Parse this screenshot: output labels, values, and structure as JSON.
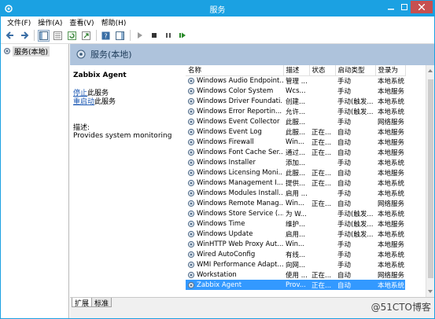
{
  "window": {
    "title": "服务"
  },
  "menu": [
    "文件(F)",
    "操作(A)",
    "查看(V)",
    "帮助(H)"
  ],
  "tree": {
    "root_label": "服务(本地)"
  },
  "header": {
    "title": "服务(本地)"
  },
  "details": {
    "service_name": "Zabbix Agent",
    "stop_link": "停止",
    "stop_suffix": "此服务",
    "restart_link": "重启动",
    "restart_suffix": "此服务",
    "desc_label": "描述:",
    "desc_text": "Provides system monitoring"
  },
  "columns": [
    "名称",
    "描述",
    "状态",
    "启动类型",
    "登录为"
  ],
  "rows": [
    {
      "name": "Windows Audio Endpoint...",
      "desc": "管理 ...",
      "status": "",
      "startup": "手动",
      "logon": "本地系统"
    },
    {
      "name": "Windows Color System",
      "desc": "Wcs...",
      "status": "",
      "startup": "手动",
      "logon": "本地服务"
    },
    {
      "name": "Windows Driver Foundati...",
      "desc": "创建...",
      "status": "",
      "startup": "手动(触发...",
      "logon": "本地系统"
    },
    {
      "name": "Windows Error Reportin...",
      "desc": "允许...",
      "status": "",
      "startup": "手动(触发...",
      "logon": "本地系统"
    },
    {
      "name": "Windows Event Collector",
      "desc": "此服...",
      "status": "",
      "startup": "手动",
      "logon": "网络服务"
    },
    {
      "name": "Windows Event Log",
      "desc": "此服...",
      "status": "正在...",
      "startup": "自动",
      "logon": "本地服务"
    },
    {
      "name": "Windows Firewall",
      "desc": "Win...",
      "status": "正在...",
      "startup": "自动",
      "logon": "本地服务"
    },
    {
      "name": "Windows Font Cache Ser...",
      "desc": "通过...",
      "status": "正在...",
      "startup": "自动",
      "logon": "本地服务"
    },
    {
      "name": "Windows Installer",
      "desc": "添加...",
      "status": "",
      "startup": "手动",
      "logon": "本地系统"
    },
    {
      "name": "Windows Licensing Moni...",
      "desc": "此服...",
      "status": "正在...",
      "startup": "自动",
      "logon": "本地服务"
    },
    {
      "name": "Windows Management I...",
      "desc": "提供...",
      "status": "正在...",
      "startup": "自动",
      "logon": "本地系统"
    },
    {
      "name": "Windows Modules Install...",
      "desc": "启用 ...",
      "status": "",
      "startup": "手动",
      "logon": "本地系统"
    },
    {
      "name": "Windows Remote Manag...",
      "desc": "Win...",
      "status": "正在...",
      "startup": "自动",
      "logon": "网络服务"
    },
    {
      "name": "Windows Store Service (...",
      "desc": "为 W...",
      "status": "",
      "startup": "手动(触发...",
      "logon": "本地系统"
    },
    {
      "name": "Windows Time",
      "desc": "维护...",
      "status": "",
      "startup": "手动(触发...",
      "logon": "本地服务"
    },
    {
      "name": "Windows Update",
      "desc": "启用...",
      "status": "",
      "startup": "手动(触发...",
      "logon": "本地系统"
    },
    {
      "name": "WinHTTP Web Proxy Aut...",
      "desc": "Win...",
      "status": "",
      "startup": "手动",
      "logon": "本地服务"
    },
    {
      "name": "Wired AutoConfig",
      "desc": "有线...",
      "status": "",
      "startup": "手动",
      "logon": "本地系统"
    },
    {
      "name": "WMI Performance Adapt...",
      "desc": "向网...",
      "status": "",
      "startup": "手动",
      "logon": "本地系统"
    },
    {
      "name": "Workstation",
      "desc": "使用 ...",
      "status": "正在...",
      "startup": "自动",
      "logon": "网络服务"
    },
    {
      "name": "Zabbix Agent",
      "desc": "Prov...",
      "status": "正在...",
      "startup": "自动",
      "logon": "本地系统",
      "selected": true
    }
  ],
  "tabs": [
    "扩展",
    "标准"
  ],
  "watermark": "@51CTO博客",
  "colors": {
    "accent": "#1ba1e2",
    "selection": "#3399ff",
    "header_band": "#aec3dc"
  }
}
